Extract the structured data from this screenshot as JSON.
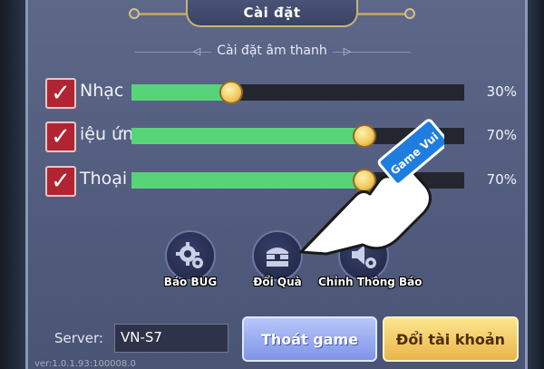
{
  "dialog": {
    "title": "Cài đặt"
  },
  "sound_section": {
    "heading": "Cài đặt âm thanh"
  },
  "sound_rows": [
    {
      "label": "Nhạc",
      "checked": true,
      "value_pct": 30,
      "value_text": "30%"
    },
    {
      "label": "iệu ứng",
      "checked": true,
      "value_pct": 70,
      "value_text": "70%"
    },
    {
      "label": "Thoại",
      "checked": true,
      "value_pct": 70,
      "value_text": "70%"
    }
  ],
  "actions": {
    "report_bug": "Báo BUG",
    "redeem_gift": "Đổi Quà",
    "notification_settings": "Chỉnh Thông Báo"
  },
  "server": {
    "label": "Server:",
    "value": "VN-S7"
  },
  "buttons": {
    "exit_game": "Thoát game",
    "switch_account": "Đổi tài khoản"
  },
  "version": "ver:1.0.1.93:100008.0",
  "watermark": "Game Vui",
  "colors": {
    "slider_fill": "#56d477",
    "checkbox": "#b12533",
    "exit_button": "#9caef2",
    "switch_button": "#f4cf6c"
  }
}
